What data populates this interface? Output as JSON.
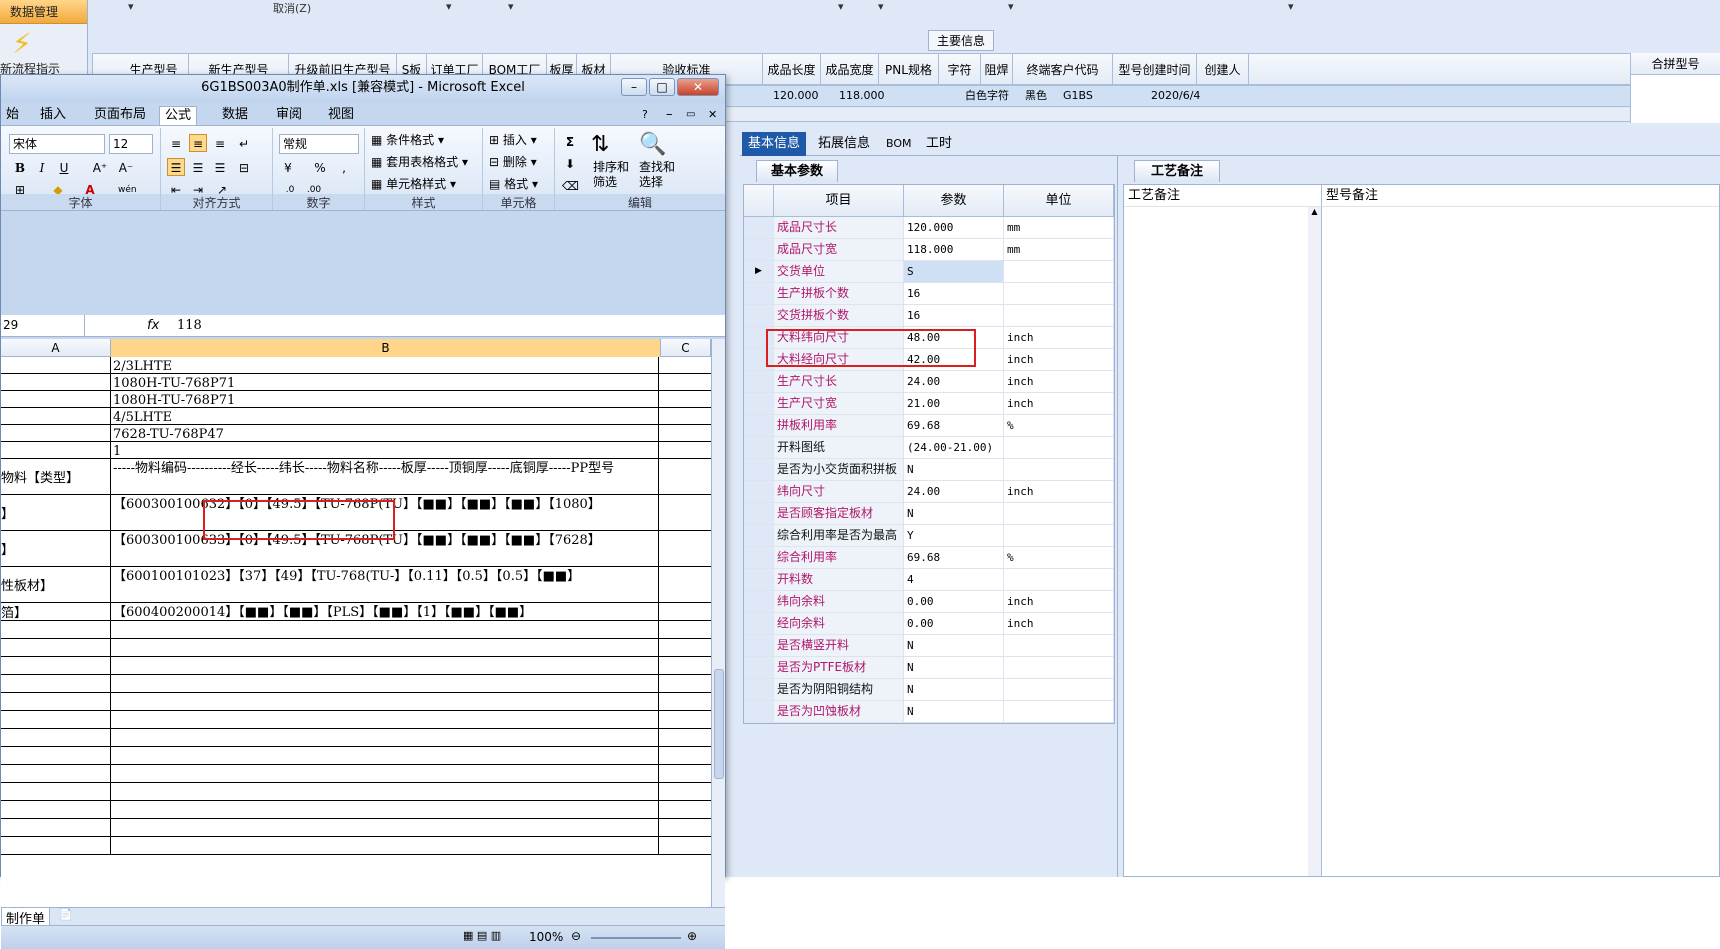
{
  "app": {
    "nav_header": "数据管理",
    "nav_label": "新流程指示",
    "cancel_label": "取消(Z)",
    "main_info_title": "主要信息",
    "grid_columns": [
      "生产型号",
      "新生产型号",
      "升级前旧生产型号",
      "S板",
      "订单工厂",
      "BOM工厂",
      "板厚",
      "板材",
      "验收标准",
      "成品长度",
      "成品宽度",
      "PNL规格",
      "字符",
      "阻焊",
      "终端客户代码",
      "型号创建时间",
      "创建人"
    ],
    "grid_row": {
      "length": "120.000",
      "width": "118.000",
      "char": "白色字符",
      "solder": "黑色",
      "cust": "G1BS",
      "created": "2020/6/4"
    },
    "merge_header": "合拼型号",
    "tabs": [
      "基本信息",
      "拓展信息",
      "BOM",
      "工时"
    ],
    "params_tab": "基本参数",
    "param_headers": [
      "项目",
      "参数",
      "单位"
    ],
    "params": [
      {
        "name": "成品尺寸长",
        "value": "120.000",
        "unit": "mm",
        "pink": true
      },
      {
        "name": "成品尺寸宽",
        "value": "118.000",
        "unit": "mm",
        "pink": true
      },
      {
        "name": "交货单位",
        "value": "S",
        "unit": "",
        "pink": true
      },
      {
        "name": "生产拼板个数",
        "value": "16",
        "unit": "",
        "pink": true
      },
      {
        "name": "交货拼板个数",
        "value": "16",
        "unit": "",
        "pink": true
      },
      {
        "name": "大料纬向尺寸",
        "value": "48.00",
        "unit": "inch",
        "pink": true
      },
      {
        "name": "大料经向尺寸",
        "value": "42.00",
        "unit": "inch",
        "pink": true
      },
      {
        "name": "生产尺寸长",
        "value": "24.00",
        "unit": "inch",
        "pink": true
      },
      {
        "name": "生产尺寸宽",
        "value": "21.00",
        "unit": "inch",
        "pink": true
      },
      {
        "name": "拼板利用率",
        "value": "69.68",
        "unit": "%",
        "pink": true
      },
      {
        "name": "开料图纸",
        "value": "(24.00-21.00)",
        "unit": "",
        "pink": false
      },
      {
        "name": "是否为小交货面积拼板",
        "value": "N",
        "unit": "",
        "pink": false
      },
      {
        "name": "纬向尺寸",
        "value": "24.00",
        "unit": "inch",
        "pink": true
      },
      {
        "name": "是否顾客指定板材",
        "value": "N",
        "unit": "",
        "pink": true
      },
      {
        "name": "综合利用率是否为最高",
        "value": "Y",
        "unit": "",
        "pink": false
      },
      {
        "name": "综合利用率",
        "value": "69.68",
        "unit": "%",
        "pink": true
      },
      {
        "name": "开料数",
        "value": "4",
        "unit": "",
        "pink": true
      },
      {
        "name": "纬向余料",
        "value": "0.00",
        "unit": "inch",
        "pink": true
      },
      {
        "name": "经向余料",
        "value": "0.00",
        "unit": "inch",
        "pink": true
      },
      {
        "name": "是否横竖开料",
        "value": "N",
        "unit": "",
        "pink": true
      },
      {
        "name": "是否为PTFE板材",
        "value": "N",
        "unit": "",
        "pink": true
      },
      {
        "name": "是否为阴阳铜结构",
        "value": "N",
        "unit": "",
        "pink": false
      },
      {
        "name": "是否为凹蚀板材",
        "value": "N",
        "unit": "",
        "pink": true
      }
    ],
    "notes_tab": "工艺备注",
    "notes_headers": [
      "工艺备注",
      "型号备注"
    ]
  },
  "excel": {
    "title": "6G1BS003A0制作单.xls  [兼容模式] - Microsoft Excel",
    "ribbon_tabs": [
      "始",
      "插入",
      "页面布局",
      "公式",
      "数据",
      "审阅",
      "视图"
    ],
    "font_name": "宋体",
    "font_size": "12",
    "number_format": "常规",
    "style_items": [
      "条件格式",
      "套用表格格式",
      "单元格样式"
    ],
    "cell_items": [
      "插入",
      "删除",
      "格式"
    ],
    "edit_items": [
      "排序和筛选",
      "查找和选择"
    ],
    "groups": [
      "字体",
      "对齐方式",
      "数字",
      "样式",
      "单元格",
      "编辑"
    ],
    "name_box": "29",
    "formula": "118",
    "columns": [
      "A",
      "B",
      "C"
    ],
    "rows": [
      {
        "a": "",
        "b": "2/3LHTE",
        "h": 17
      },
      {
        "a": "",
        "b": "1080H-TU-768P71",
        "h": 17
      },
      {
        "a": "",
        "b": "1080H-TU-768P71",
        "h": 17
      },
      {
        "a": "",
        "b": "4/5LHTE",
        "h": 17
      },
      {
        "a": "",
        "b": "7628-TU-768P47",
        "h": 17
      },
      {
        "a": "",
        "b": "1",
        "h": 17
      },
      {
        "a": "物料【类型】",
        "b": "-----物料编码----------经长-----纬长-----物料名称-----板厚-----顶铜厚-----底铜厚-----PP型号",
        "h": 36
      },
      {
        "a": "】",
        "b": "【600300100632】【0】【49.5】【TU-768P(TU】【■■】【■■】【■■】【1080】",
        "h": 36
      },
      {
        "a": "】",
        "b": "【600300100633】【0】【49.5】【TU-768P(TU】【■■】【■■】【■■】【7628】",
        "h": 36
      },
      {
        "a": "性板材】",
        "b": "【600100101023】【37】【49】【TU-768(TU-】【0.11】【0.5】【0.5】【■■】",
        "h": 36
      },
      {
        "a": "箔】",
        "b": "【600400200014】【■■】【■■】【PLS】【■■】【1】【■■】【■■】",
        "h": 18
      },
      {
        "a": "",
        "b": "",
        "h": 18
      },
      {
        "a": "",
        "b": "",
        "h": 18
      },
      {
        "a": "",
        "b": "",
        "h": 18
      },
      {
        "a": "",
        "b": "",
        "h": 18
      },
      {
        "a": "",
        "b": "",
        "h": 18
      },
      {
        "a": "",
        "b": "",
        "h": 18
      },
      {
        "a": "",
        "b": "",
        "h": 18
      },
      {
        "a": "",
        "b": "",
        "h": 18
      },
      {
        "a": "",
        "b": "",
        "h": 18
      },
      {
        "a": "",
        "b": "",
        "h": 18
      },
      {
        "a": "",
        "b": "",
        "h": 18
      },
      {
        "a": "",
        "b": "",
        "h": 18
      },
      {
        "a": "",
        "b": "",
        "h": 18
      }
    ],
    "sheet_tab": "制作单",
    "zoom": "100%"
  }
}
